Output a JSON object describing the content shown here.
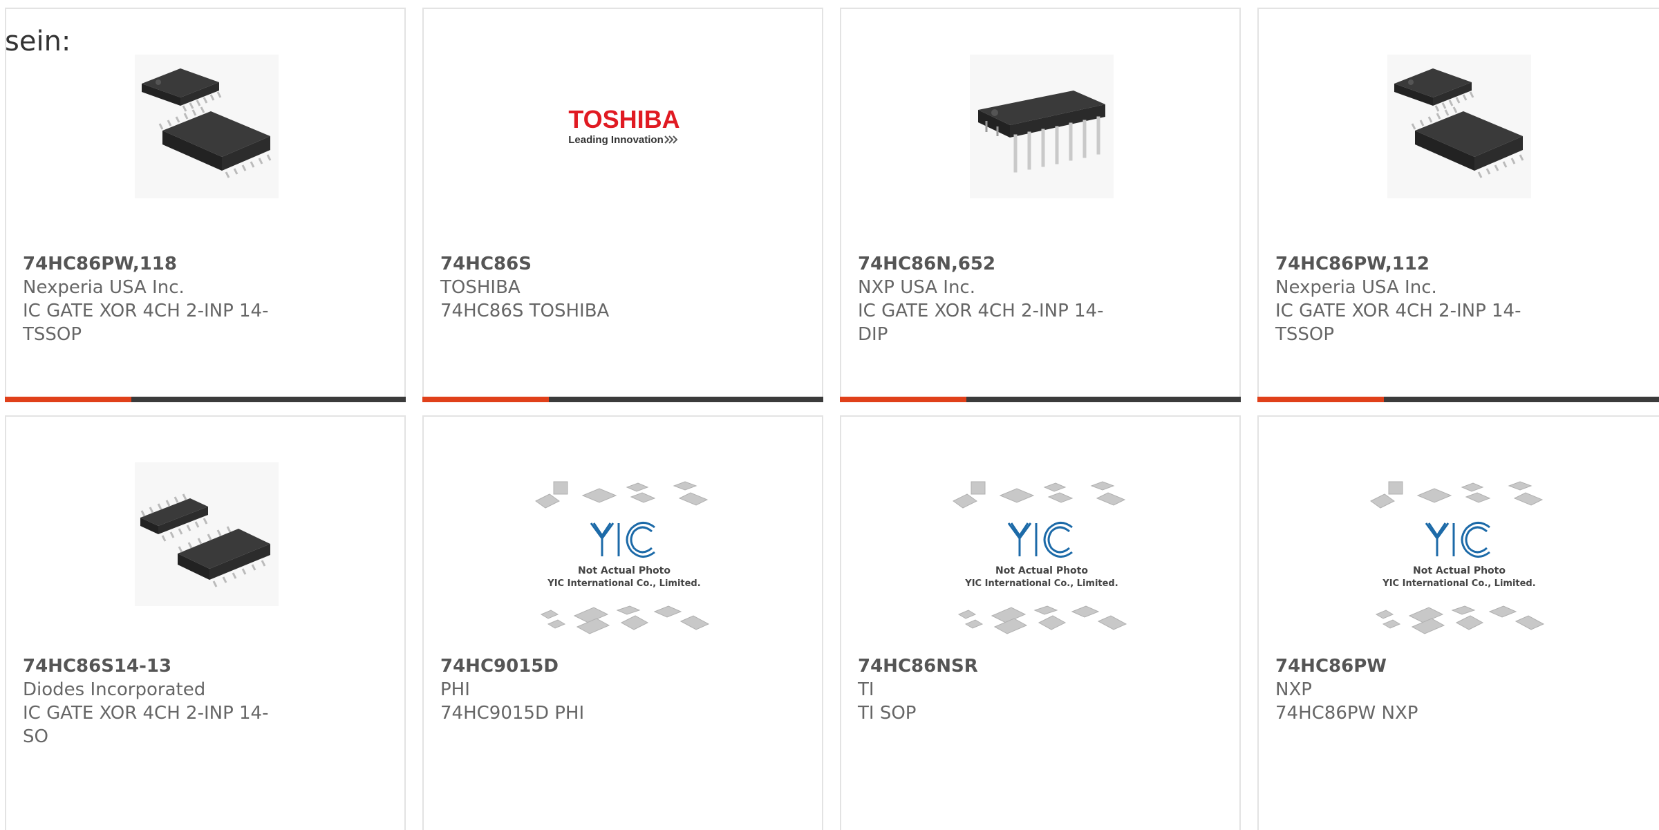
{
  "intro_text": "sein:",
  "colors": {
    "accent": "#e0401a",
    "bar": "#3b3b3b",
    "border": "#e3e3e3"
  },
  "cards": [
    {
      "part": "74HC86PW,118",
      "maker": "Nexperia USA Inc.",
      "desc": "IC GATE XOR 4CH 2-INP 14-TSSOP",
      "image": "tssop-chip-image"
    },
    {
      "part": "74HC86S",
      "maker": "TOSHIBA",
      "desc": "74HC86S TOSHIBA",
      "image": "toshiba-logo",
      "logo_main": "TOSHIBA",
      "logo_tagline": "Leading Innovation"
    },
    {
      "part": "74HC86N,652",
      "maker": "NXP USA Inc.",
      "desc": "IC GATE XOR 4CH 2-INP 14-DIP",
      "image": "dip-chip-image"
    },
    {
      "part": "74HC86PW,112",
      "maker": "Nexperia USA Inc.",
      "desc": "IC GATE XOR 4CH 2-INP 14-TSSOP",
      "image": "tssop-chip-image"
    },
    {
      "part": "74HC86S14-13",
      "maker": "Diodes Incorporated",
      "desc": "IC GATE XOR 4CH 2-INP 14-SO",
      "image": "so-chip-image"
    },
    {
      "part": "74HC9015D",
      "maker": "PHI",
      "desc": "74HC9015D PHI",
      "image": "yic-placeholder-image",
      "placeholder_line1": "Not Actual Photo",
      "placeholder_line2": "YIC International Co., Limited."
    },
    {
      "part": "74HC86NSR",
      "maker": "TI",
      "desc": "TI SOP",
      "image": "yic-placeholder-image",
      "placeholder_line1": "Not Actual Photo",
      "placeholder_line2": "YIC International Co., Limited."
    },
    {
      "part": "74HC86PW",
      "maker": "NXP",
      "desc": "74HC86PW NXP",
      "image": "yic-placeholder-image",
      "placeholder_line1": "Not Actual Photo",
      "placeholder_line2": "YIC International Co., Limited."
    }
  ]
}
